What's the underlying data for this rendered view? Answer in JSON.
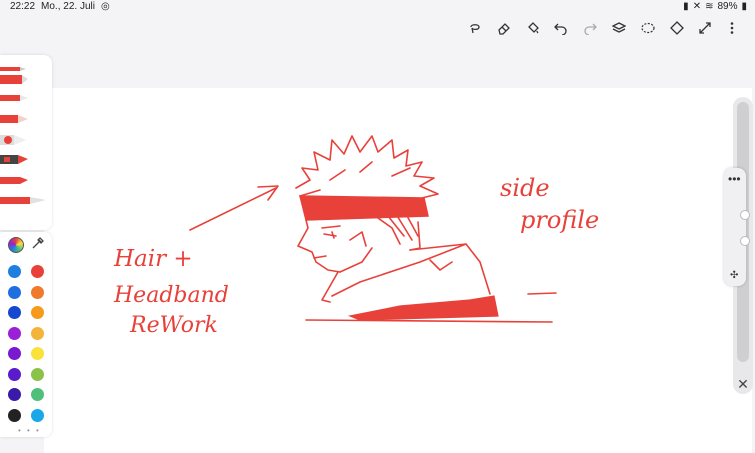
{
  "status": {
    "time": "22:22",
    "date": "Mo., 22. Juli",
    "battery": "89%"
  },
  "toolbar": {
    "icons": [
      "lasso-icon",
      "eraser-icon",
      "fill-icon",
      "undo-icon",
      "redo-icon",
      "layers-icon",
      "selection-icon",
      "transform-icon",
      "fullscreen-icon",
      "more-icon"
    ]
  },
  "colors": {
    "palette": [
      "#1e7fe0",
      "#e8413a",
      "#1f6fe0",
      "#f07a2b",
      "#1547d0",
      "#f59b1c",
      "#9b1fd6",
      "#f4b43a",
      "#7a1ad0",
      "#f8e23b",
      "#5a1bcc",
      "#8bc34a",
      "#3a1aa8",
      "#4fbf7a",
      "#222222",
      "#19a7e8"
    ],
    "current": "#e8413a"
  },
  "drawing": {
    "note_left_1": "Hair +",
    "note_left_2": "Headband",
    "note_left_3": "ReWork",
    "note_right_1": "side",
    "note_right_2": "profile"
  }
}
